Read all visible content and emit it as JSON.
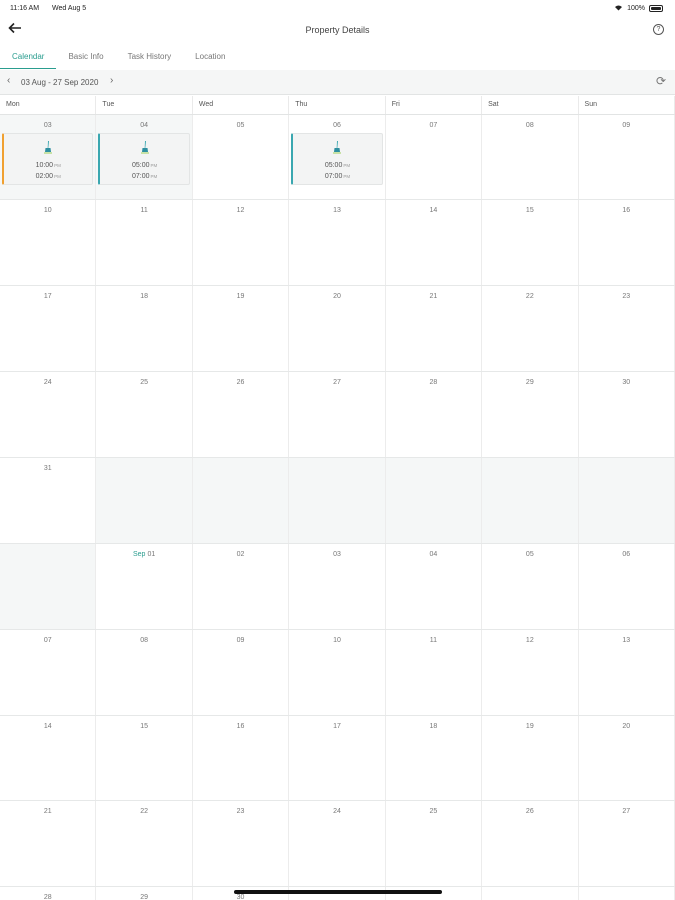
{
  "status_bar": {
    "time": "11:16 AM",
    "date": "Wed Aug 5",
    "battery": "100%"
  },
  "nav": {
    "title": "Property Details",
    "back_icon": "back-arrow-icon",
    "help_icon": "help-icon",
    "help_glyph": "?"
  },
  "tabs": [
    {
      "label": "Calendar",
      "active": true
    },
    {
      "label": "Basic Info",
      "active": false
    },
    {
      "label": "Task History",
      "active": false
    },
    {
      "label": "Location",
      "active": false
    }
  ],
  "range": {
    "label": "03 Aug - 27 Sep 2020",
    "prev_glyph": "‹",
    "next_glyph": "›",
    "refresh_glyph": "⟳"
  },
  "weekdays": [
    "Mon",
    "Tue",
    "Wed",
    "Thu",
    "Fri",
    "Sat",
    "Sun"
  ],
  "colors": {
    "accent": "#2a9d8f",
    "event_orange": "#f0a030",
    "event_teal": "#3aa7b0"
  },
  "weeks": [
    {
      "days": [
        {
          "num": "03",
          "shaded": true,
          "event": {
            "start": "10:00",
            "end": "02:00",
            "start_suffix": "PM",
            "end_suffix": "PM",
            "accent": "orange"
          }
        },
        {
          "num": "04",
          "shaded": true,
          "event": {
            "start": "05:00",
            "end": "07:00",
            "start_suffix": "PM",
            "end_suffix": "PM",
            "accent": "teal"
          }
        },
        {
          "num": "05",
          "shaded": false
        },
        {
          "num": "06",
          "shaded": false,
          "event": {
            "start": "05:00",
            "end": "07:00",
            "start_suffix": "PM",
            "end_suffix": "PM",
            "accent": "teal"
          }
        },
        {
          "num": "07",
          "shaded": false
        },
        {
          "num": "08",
          "shaded": false
        },
        {
          "num": "09",
          "shaded": false
        }
      ]
    },
    {
      "days": [
        {
          "num": "10"
        },
        {
          "num": "11"
        },
        {
          "num": "12"
        },
        {
          "num": "13"
        },
        {
          "num": "14"
        },
        {
          "num": "15"
        },
        {
          "num": "16"
        }
      ]
    },
    {
      "days": [
        {
          "num": "17"
        },
        {
          "num": "18"
        },
        {
          "num": "19"
        },
        {
          "num": "20"
        },
        {
          "num": "21"
        },
        {
          "num": "22"
        },
        {
          "num": "23"
        }
      ]
    },
    {
      "days": [
        {
          "num": "24"
        },
        {
          "num": "25"
        },
        {
          "num": "26"
        },
        {
          "num": "27"
        },
        {
          "num": "28"
        },
        {
          "num": "29"
        },
        {
          "num": "30"
        }
      ]
    },
    {
      "days": [
        {
          "num": "31"
        },
        {
          "num": "",
          "shaded": true
        },
        {
          "num": "",
          "shaded": true
        },
        {
          "num": "",
          "shaded": true
        },
        {
          "num": "",
          "shaded": true
        },
        {
          "num": "",
          "shaded": true
        },
        {
          "num": "",
          "shaded": true
        }
      ]
    },
    {
      "days": [
        {
          "num": "",
          "shaded": true
        },
        {
          "num": "01",
          "month": "Sep"
        },
        {
          "num": "02"
        },
        {
          "num": "03"
        },
        {
          "num": "04"
        },
        {
          "num": "05"
        },
        {
          "num": "06"
        }
      ]
    },
    {
      "days": [
        {
          "num": "07"
        },
        {
          "num": "08"
        },
        {
          "num": "09"
        },
        {
          "num": "10"
        },
        {
          "num": "11"
        },
        {
          "num": "12"
        },
        {
          "num": "13"
        }
      ]
    },
    {
      "days": [
        {
          "num": "14"
        },
        {
          "num": "15"
        },
        {
          "num": "16"
        },
        {
          "num": "17"
        },
        {
          "num": "18"
        },
        {
          "num": "19"
        },
        {
          "num": "20"
        }
      ]
    },
    {
      "days": [
        {
          "num": "21"
        },
        {
          "num": "22"
        },
        {
          "num": "23"
        },
        {
          "num": "24"
        },
        {
          "num": "25"
        },
        {
          "num": "26"
        },
        {
          "num": "27"
        }
      ]
    },
    {
      "days": [
        {
          "num": "28"
        },
        {
          "num": "29"
        },
        {
          "num": "30"
        },
        {
          "num": ""
        },
        {
          "num": ""
        },
        {
          "num": ""
        },
        {
          "num": ""
        }
      ]
    }
  ]
}
